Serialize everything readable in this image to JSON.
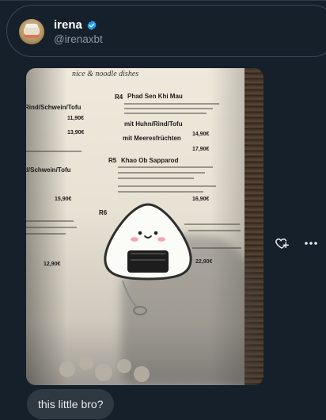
{
  "author": {
    "name": "irena",
    "handle": "@irenaxbt",
    "verified": true,
    "verified_color": "#1d9bf0"
  },
  "menu_photo": {
    "section_heading": "nice & noodle dishes",
    "items": [
      {
        "code": "R4",
        "dish": "Phad Sen Khi Mau",
        "variant": "mit Huhn/Rind/Tofu",
        "price": "14,90€"
      },
      {
        "code": "",
        "dish": "mit Meeresfrüchten",
        "price": "17,90€"
      },
      {
        "code": "R5",
        "dish": "Khao Ob Sapparod",
        "price": "16,90€"
      },
      {
        "code": "R6",
        "dish": "",
        "price": "22,90€"
      }
    ],
    "left_prices": [
      "11,90€",
      "13,90€",
      "15,90€",
      "12,90€"
    ],
    "left_items": [
      "Rind/Schwein/Tofu",
      "d/Schwein/Tofu"
    ]
  },
  "message": {
    "caption": "this little bro?"
  },
  "actions": {
    "react_icon": "heart-plus-icon",
    "more_icon": "more-icon"
  }
}
